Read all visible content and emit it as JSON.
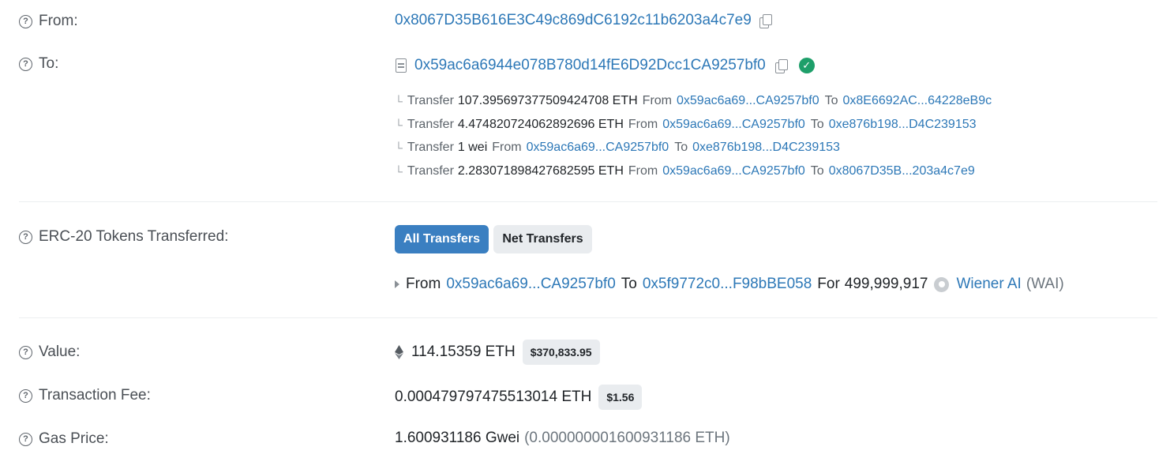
{
  "labels": {
    "from": "From:",
    "to": "To:",
    "erc20": "ERC-20 Tokens Transferred:",
    "value": "Value:",
    "fee": "Transaction Fee:",
    "gas": "Gas Price:"
  },
  "help_icon_glyph": "?",
  "from_address": "0x8067D35B616E3C49c869dC6192c11b6203a4c7e9",
  "to_address": "0x59ac6a6944e078B780d14fE6D92Dcc1CA9257bf0",
  "internal_transfers": [
    {
      "word": "Transfer",
      "amount": "107.395697377509424708 ETH",
      "from_kw": "From",
      "from": "0x59ac6a69...CA9257bf0",
      "to_kw": "To",
      "to": "0x8E6692AC...64228eB9c"
    },
    {
      "word": "Transfer",
      "amount": "4.474820724062892696 ETH",
      "from_kw": "From",
      "from": "0x59ac6a69...CA9257bf0",
      "to_kw": "To",
      "to": "0xe876b198...D4C239153"
    },
    {
      "word": "Transfer",
      "amount": "1 wei",
      "from_kw": "From",
      "from": "0x59ac6a69...CA9257bf0",
      "to_kw": "To",
      "to": "0xe876b198...D4C239153"
    },
    {
      "word": "Transfer",
      "amount": "2.283071898427682595 ETH",
      "from_kw": "From",
      "from": "0x59ac6a69...CA9257bf0",
      "to_kw": "To",
      "to": "0x8067D35B...203a4c7e9"
    }
  ],
  "erc20": {
    "tabs": {
      "all": "All Transfers",
      "net": "Net Transfers"
    },
    "transfer": {
      "from_kw": "From",
      "from": "0x59ac6a69...CA9257bf0",
      "to_kw": "To",
      "to": "0x5f9772c0...F98bBE058",
      "for_kw": "For",
      "amount": "499,999,917",
      "token_name": "Wiener AI",
      "token_symbol": "(WAI)"
    }
  },
  "value": {
    "amount": "114.15359 ETH",
    "usd": "$370,833.95"
  },
  "fee": {
    "amount": "0.000479797475513014 ETH",
    "usd": "$1.56"
  },
  "gas": {
    "gwei": "1.600931186 Gwei",
    "eth": "(0.000000001600931186 ETH)"
  },
  "colors": {
    "link": "#2d78b7",
    "primary_button": "#3a7fc1",
    "success": "#1e9f6a",
    "badge_bg": "#e9ecef"
  }
}
